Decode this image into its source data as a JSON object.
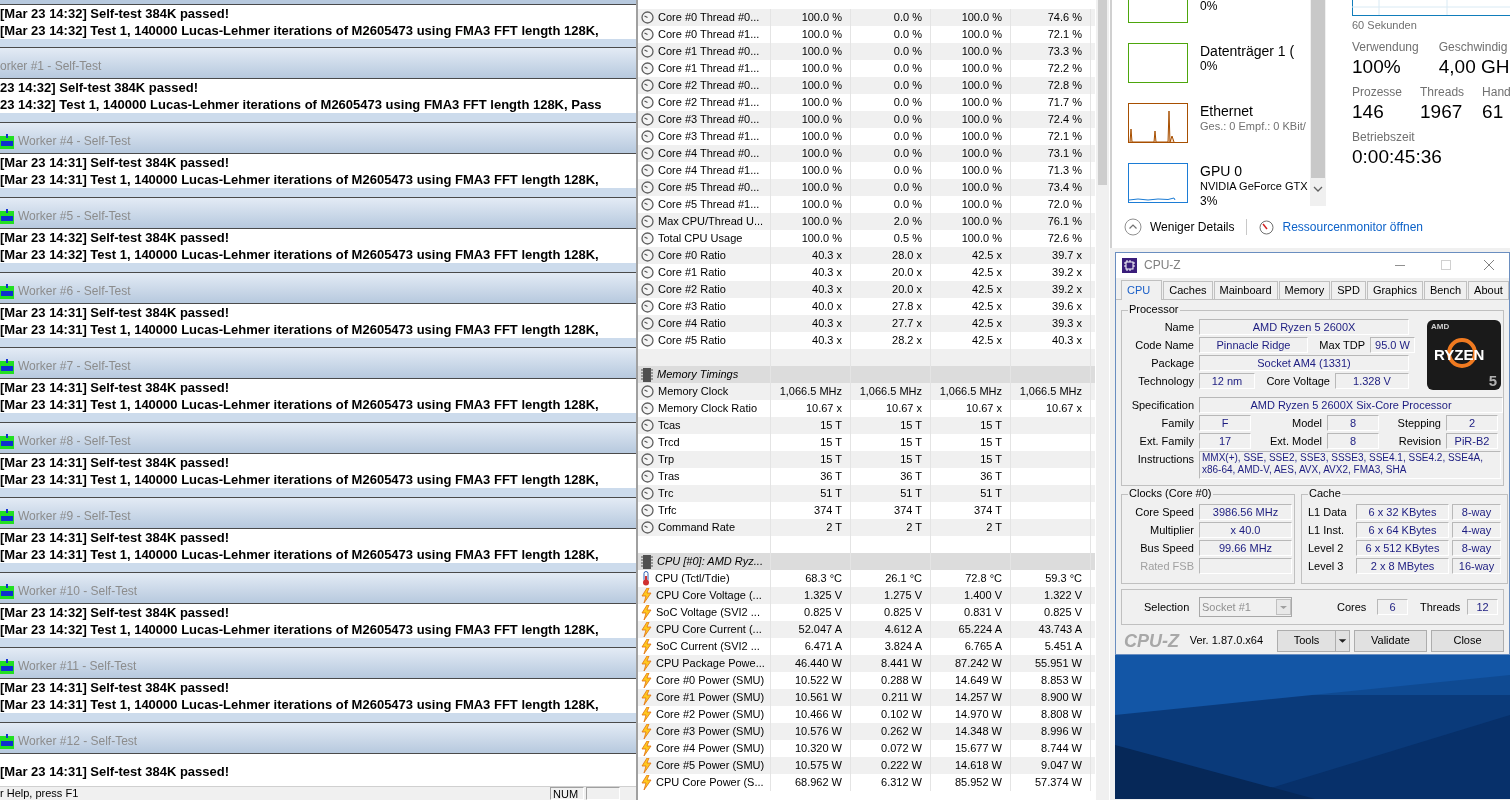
{
  "prime95": {
    "blocks": [
      {
        "lines": [
          "[Mar 23 14:32] Self-test 384K passed!",
          "[Mar 23 14:32] Test 1, 140000 Lucas-Lehmer iterations of M2605473 using FMA3 FFT length 128K,"
        ]
      },
      {
        "title": "orker #1 - Self-Test",
        "icon": false,
        "lines": [
          "23 14:32] Self-test 384K passed!",
          "23 14:32] Test 1, 140000 Lucas-Lehmer iterations of M2605473 using FMA3 FFT length 128K, Pass"
        ]
      },
      {
        "title": "Worker #4 - Self-Test",
        "icon": true,
        "lines": [
          "[Mar 23 14:31] Self-test 384K passed!",
          "[Mar 23 14:31] Test 1, 140000 Lucas-Lehmer iterations of M2605473 using FMA3 FFT length 128K,"
        ]
      },
      {
        "title": "Worker #5 - Self-Test",
        "icon": true,
        "lines": [
          "[Mar 23 14:32] Self-test 384K passed!",
          "[Mar 23 14:32] Test 1, 140000 Lucas-Lehmer iterations of M2605473 using FMA3 FFT length 128K,"
        ]
      },
      {
        "title": "Worker #6 - Self-Test",
        "icon": true,
        "lines": [
          "[Mar 23 14:31] Self-test 384K passed!",
          "[Mar 23 14:31] Test 1, 140000 Lucas-Lehmer iterations of M2605473 using FMA3 FFT length 128K,"
        ]
      },
      {
        "title": "Worker #7 - Self-Test",
        "icon": true,
        "lines": [
          "[Mar 23 14:31] Self-test 384K passed!",
          "[Mar 23 14:31] Test 1, 140000 Lucas-Lehmer iterations of M2605473 using FMA3 FFT length 128K,"
        ]
      },
      {
        "title": "Worker #8 - Self-Test",
        "icon": true,
        "lines": [
          "[Mar 23 14:31] Self-test 384K passed!",
          "[Mar 23 14:31] Test 1, 140000 Lucas-Lehmer iterations of M2605473 using FMA3 FFT length 128K,"
        ]
      },
      {
        "title": "Worker #9 - Self-Test",
        "icon": true,
        "lines": [
          "[Mar 23 14:31] Self-test 384K passed!",
          "[Mar 23 14:31] Test 1, 140000 Lucas-Lehmer iterations of M2605473 using FMA3 FFT length 128K,"
        ]
      },
      {
        "title": "Worker #10 - Self-Test",
        "icon": true,
        "lines": [
          "[Mar 23 14:32] Self-test 384K passed!",
          "[Mar 23 14:32] Test 1, 140000 Lucas-Lehmer iterations of M2605473 using FMA3 FFT length 128K,"
        ]
      },
      {
        "title": "Worker #11 - Self-Test",
        "icon": true,
        "lines": [
          "[Mar 23 14:31] Self-test 384K passed!",
          "[Mar 23 14:31] Test 1, 140000 Lucas-Lehmer iterations of M2605473 using FMA3 FFT length 128K,"
        ]
      },
      {
        "title": "Worker #12 - Self-Test",
        "icon": true,
        "lines": [
          "[Mar 23 14:31] Self-test 384K passed!"
        ]
      }
    ],
    "status_bar": {
      "text": "r Help, press F1",
      "panels": [
        "NUM"
      ]
    }
  },
  "sensors": {
    "rows": [
      {
        "kind": "usage",
        "label": "Core #0 Thread #0...",
        "values": [
          "100.0 %",
          "0.0 %",
          "100.0 %",
          "74.6 %"
        ]
      },
      {
        "kind": "usage",
        "label": "Core #0 Thread #1...",
        "values": [
          "100.0 %",
          "0.0 %",
          "100.0 %",
          "72.1 %"
        ]
      },
      {
        "kind": "usage",
        "label": "Core #1 Thread #0...",
        "values": [
          "100.0 %",
          "0.0 %",
          "100.0 %",
          "73.3 %"
        ]
      },
      {
        "kind": "usage",
        "label": "Core #1 Thread #1...",
        "values": [
          "100.0 %",
          "0.0 %",
          "100.0 %",
          "72.2 %"
        ]
      },
      {
        "kind": "usage",
        "label": "Core #2 Thread #0...",
        "values": [
          "100.0 %",
          "0.0 %",
          "100.0 %",
          "72.8 %"
        ]
      },
      {
        "kind": "usage",
        "label": "Core #2 Thread #1...",
        "values": [
          "100.0 %",
          "0.0 %",
          "100.0 %",
          "71.7 %"
        ]
      },
      {
        "kind": "usage",
        "label": "Core #3 Thread #0...",
        "values": [
          "100.0 %",
          "0.0 %",
          "100.0 %",
          "72.4 %"
        ]
      },
      {
        "kind": "usage",
        "label": "Core #3 Thread #1...",
        "values": [
          "100.0 %",
          "0.0 %",
          "100.0 %",
          "72.1 %"
        ]
      },
      {
        "kind": "usage",
        "label": "Core #4 Thread #0...",
        "values": [
          "100.0 %",
          "0.0 %",
          "100.0 %",
          "73.1 %"
        ]
      },
      {
        "kind": "usage",
        "label": "Core #4 Thread #1...",
        "values": [
          "100.0 %",
          "0.0 %",
          "100.0 %",
          "71.3 %"
        ]
      },
      {
        "kind": "usage",
        "label": "Core #5 Thread #0...",
        "values": [
          "100.0 %",
          "0.0 %",
          "100.0 %",
          "73.4 %"
        ]
      },
      {
        "kind": "usage",
        "label": "Core #5 Thread #1...",
        "values": [
          "100.0 %",
          "0.0 %",
          "100.0 %",
          "72.0 %"
        ]
      },
      {
        "kind": "usage",
        "label": "Max CPU/Thread U...",
        "values": [
          "100.0 %",
          "2.0 %",
          "100.0 %",
          "76.1 %"
        ]
      },
      {
        "kind": "usage",
        "label": "Total CPU Usage",
        "values": [
          "100.0 %",
          "0.5 %",
          "100.0 %",
          "72.6 %"
        ]
      },
      {
        "kind": "usage",
        "label": "Core #0 Ratio",
        "values": [
          "40.3 x",
          "28.0 x",
          "42.5 x",
          "39.7 x"
        ]
      },
      {
        "kind": "usage",
        "label": "Core #1 Ratio",
        "values": [
          "40.3 x",
          "20.0 x",
          "42.5 x",
          "39.2 x"
        ]
      },
      {
        "kind": "usage",
        "label": "Core #2 Ratio",
        "values": [
          "40.3 x",
          "20.0 x",
          "42.5 x",
          "39.2 x"
        ]
      },
      {
        "kind": "usage",
        "label": "Core #3 Ratio",
        "values": [
          "40.0 x",
          "27.8 x",
          "42.5 x",
          "39.6 x"
        ]
      },
      {
        "kind": "usage",
        "label": "Core #4 Ratio",
        "values": [
          "40.3 x",
          "27.7 x",
          "42.5 x",
          "39.3 x"
        ]
      },
      {
        "kind": "usage",
        "label": "Core #5 Ratio",
        "values": [
          "40.3 x",
          "28.2 x",
          "42.5 x",
          "40.3 x"
        ]
      },
      {
        "kind": "spacer"
      },
      {
        "kind": "section",
        "label": "Memory Timings"
      },
      {
        "kind": "usage",
        "label": "Memory Clock",
        "values": [
          "1,066.5 MHz",
          "1,066.5 MHz",
          "1,066.5 MHz",
          "1,066.5 MHz"
        ]
      },
      {
        "kind": "usage",
        "label": "Memory Clock Ratio",
        "values": [
          "10.67 x",
          "10.67 x",
          "10.67 x",
          "10.67 x"
        ]
      },
      {
        "kind": "usage",
        "label": "Tcas",
        "values": [
          "15 T",
          "15 T",
          "15 T"
        ]
      },
      {
        "kind": "usage",
        "label": "Trcd",
        "values": [
          "15 T",
          "15 T",
          "15 T"
        ]
      },
      {
        "kind": "usage",
        "label": "Trp",
        "values": [
          "15 T",
          "15 T",
          "15 T"
        ]
      },
      {
        "kind": "usage",
        "label": "Tras",
        "values": [
          "36 T",
          "36 T",
          "36 T"
        ]
      },
      {
        "kind": "usage",
        "label": "Trc",
        "values": [
          "51 T",
          "51 T",
          "51 T"
        ]
      },
      {
        "kind": "usage",
        "label": "Trfc",
        "values": [
          "374 T",
          "374 T",
          "374 T"
        ]
      },
      {
        "kind": "usage",
        "label": "Command Rate",
        "values": [
          "2 T",
          "2 T",
          "2 T"
        ]
      },
      {
        "kind": "spacer"
      },
      {
        "kind": "section",
        "label": "CPU [#0]: AMD Ryz..."
      },
      {
        "kind": "temperature",
        "label": "CPU (Tctl/Tdie)",
        "values": [
          "68.3 °C",
          "26.1 °C",
          "72.8 °C",
          "59.3 °C"
        ]
      },
      {
        "kind": "power",
        "label": "CPU Core Voltage (...",
        "values": [
          "1.325 V",
          "1.275 V",
          "1.400 V",
          "1.322 V"
        ]
      },
      {
        "kind": "power",
        "label": "SoC Voltage (SVI2 ...",
        "values": [
          "0.825 V",
          "0.825 V",
          "0.831 V",
          "0.825 V"
        ]
      },
      {
        "kind": "power",
        "label": "CPU Core Current (...",
        "values": [
          "52.047 A",
          "4.612 A",
          "65.224 A",
          "43.743 A"
        ]
      },
      {
        "kind": "power",
        "label": "SoC Current (SVI2 ...",
        "values": [
          "6.471 A",
          "3.824 A",
          "6.765 A",
          "5.451 A"
        ]
      },
      {
        "kind": "power",
        "label": "CPU Package Powe...",
        "values": [
          "46.440 W",
          "8.441 W",
          "87.242 W",
          "55.951 W"
        ]
      },
      {
        "kind": "power",
        "label": "Core #0 Power (SMU)",
        "values": [
          "10.522 W",
          "0.288 W",
          "14.649 W",
          "8.853 W"
        ]
      },
      {
        "kind": "power",
        "label": "Core #1 Power (SMU)",
        "values": [
          "10.561 W",
          "0.211 W",
          "14.257 W",
          "8.900 W"
        ]
      },
      {
        "kind": "power",
        "label": "Core #2 Power (SMU)",
        "values": [
          "10.466 W",
          "0.102 W",
          "14.970 W",
          "8.808 W"
        ]
      },
      {
        "kind": "power",
        "label": "Core #3 Power (SMU)",
        "values": [
          "10.576 W",
          "0.262 W",
          "14.348 W",
          "8.996 W"
        ]
      },
      {
        "kind": "power",
        "label": "Core #4 Power (SMU)",
        "values": [
          "10.320 W",
          "0.072 W",
          "15.677 W",
          "8.744 W"
        ]
      },
      {
        "kind": "power",
        "label": "Core #5 Power (SMU)",
        "values": [
          "10.575 W",
          "0.222 W",
          "14.618 W",
          "9.047 W"
        ]
      },
      {
        "kind": "power",
        "label": "CPU Core Power (S...",
        "values": [
          "68.962 W",
          "6.312 W",
          "85.952 W",
          "57.374 W"
        ]
      }
    ]
  },
  "task_manager": {
    "devices": [
      {
        "kind": "disk",
        "detail": "0%"
      },
      {
        "kind": "disk",
        "name": "Datenträger 1 (",
        "detail": "0%"
      },
      {
        "kind": "ethernet",
        "name": "Ethernet",
        "detail": "Ges.: 0 Empf.: 0 KBit/"
      },
      {
        "kind": "gpu",
        "name": "GPU 0",
        "detail": "NVIDIA GeForce GTX",
        "detail2": "3%"
      }
    ],
    "graph_caption": "60 Sekunden",
    "stat_rows": [
      [
        {
          "label": "Verwendung",
          "value": "100%"
        },
        {
          "label": "Geschwindig",
          "value": "4,00 GH"
        }
      ],
      [
        {
          "label": "Prozesse",
          "value": "146"
        },
        {
          "label": "Threads",
          "value": "1967"
        },
        {
          "label": "Hand",
          "value": "61"
        }
      ],
      [
        {
          "label": "Betriebszeit",
          "value": "0:00:45:36"
        }
      ]
    ],
    "fewer_details": "Weniger Details",
    "resource_monitor": "Ressourcenmonitor öffnen"
  },
  "cpuz": {
    "title": "CPU-Z",
    "tabs": [
      {
        "label": "CPU",
        "selected": true
      },
      {
        "label": "Caches",
        "selected": false
      },
      {
        "label": "Mainboard",
        "selected": false
      },
      {
        "label": "Memory",
        "selected": false
      },
      {
        "label": "SPD",
        "selected": false
      },
      {
        "label": "Graphics",
        "selected": false
      },
      {
        "label": "Bench",
        "selected": false
      },
      {
        "label": "About",
        "selected": false
      }
    ],
    "processor": {
      "title": "Processor",
      "name": {
        "label": "Name",
        "value": "AMD Ryzen 5 2600X"
      },
      "code_name": {
        "label": "Code Name",
        "value": "Pinnacle Ridge"
      },
      "max_tdp": {
        "label": "Max TDP",
        "value": "95.0 W"
      },
      "package": {
        "label": "Package",
        "value": "Socket AM4 (1331)"
      },
      "technology": {
        "label": "Technology",
        "value": "12 nm"
      },
      "core_voltage": {
        "label": "Core Voltage",
        "value": "1.328 V"
      },
      "specification": {
        "label": "Specification",
        "value": "AMD Ryzen 5 2600X Six-Core Processor"
      },
      "family": {
        "label": "Family",
        "value": "F"
      },
      "model": {
        "label": "Model",
        "value": "8"
      },
      "stepping": {
        "label": "Stepping",
        "value": "2"
      },
      "ext_family": {
        "label": "Ext. Family",
        "value": "17"
      },
      "ext_model": {
        "label": "Ext. Model",
        "value": "8"
      },
      "revision": {
        "label": "Revision",
        "value": "PiR-B2"
      },
      "instructions": {
        "label": "Instructions",
        "value": "MMX(+), SSE, SSE2, SSE3, SSSE3, SSE4.1, SSE4.2, SSE4A, x86-64, AMD-V, AES, AVX, AVX2, FMA3, SHA"
      }
    },
    "logo": {
      "brand": "AMD",
      "name": "RYZEN",
      "tier": "5"
    },
    "clocks": {
      "title": "Clocks (Core #0)",
      "rows": [
        {
          "label": "Core Speed",
          "value": "3986.56 MHz",
          "disabled": false
        },
        {
          "label": "Multiplier",
          "value": "x 40.0",
          "disabled": false
        },
        {
          "label": "Bus Speed",
          "value": "99.66 MHz",
          "disabled": false
        },
        {
          "label": "Rated FSB",
          "disabled": true
        }
      ]
    },
    "cache": {
      "title": "Cache",
      "rows": [
        {
          "label": "L1 Data",
          "size": "6 x 32 KBytes",
          "ways": "8-way"
        },
        {
          "label": "L1 Inst.",
          "size": "6 x 64 KBytes",
          "ways": "4-way"
        },
        {
          "label": "Level 2",
          "size": "6 x 512 KBytes",
          "ways": "8-way"
        },
        {
          "label": "Level 3",
          "size": "2 x 8 MBytes",
          "ways": "16-way"
        }
      ]
    },
    "selection": {
      "label": "Selection",
      "value": "Socket #1",
      "disabled": true,
      "cores_label": "Cores",
      "cores": "6",
      "threads_label": "Threads",
      "threads": "12"
    },
    "footer": {
      "logo": "CPU-Z",
      "version": "Ver. 1.87.0.x64",
      "buttons": [
        {
          "label": "Tools",
          "menu": true
        },
        {
          "label": "Validate",
          "menu": false
        },
        {
          "label": "Close",
          "menu": false
        }
      ]
    }
  }
}
